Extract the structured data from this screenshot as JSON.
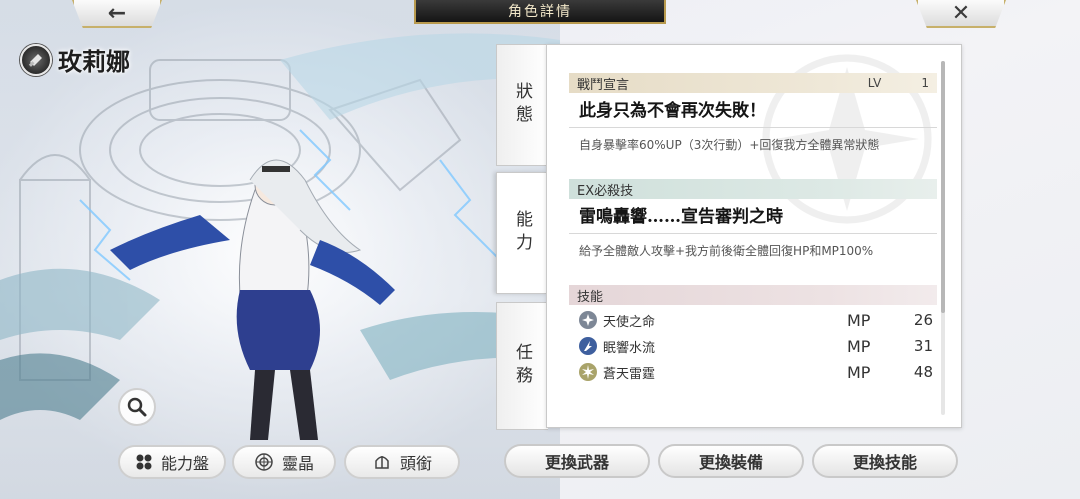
{
  "header": {
    "back_icon": "←",
    "close_icon": "✕",
    "title": "角色詳情"
  },
  "character": {
    "name": "玫莉娜"
  },
  "tabs": [
    {
      "label": "狀態",
      "active": false
    },
    {
      "label": "能力",
      "active": true
    },
    {
      "label": "任務",
      "active": false
    }
  ],
  "ability": {
    "battle_cry": {
      "header": "戰鬥宣言",
      "lv_label": "LV",
      "lv_value": "1",
      "title": "此身只為不會再次失敗！",
      "desc": "自身暴擊率60%UP（3次行動）+回復我方全體異常狀態"
    },
    "ex_skill": {
      "header": "EX必殺技",
      "title": "雷鳴轟響……宣告審判之時",
      "desc": "給予全體敵人攻擊+我方前後衛全體回復HP和MP100%"
    },
    "skills": {
      "header": "技能",
      "items": [
        {
          "name": "天使之命",
          "mp_label": "MP",
          "mp": "26",
          "icon": "angel-icon"
        },
        {
          "name": "眠響水流",
          "mp_label": "MP",
          "mp": "31",
          "icon": "water-icon"
        },
        {
          "name": "蒼天雷霆",
          "mp_label": "MP",
          "mp": "48",
          "icon": "thunder-icon"
        }
      ]
    }
  },
  "bottom_left": {
    "ability_board": "能力盤",
    "soul_crystal": "靈晶",
    "title": "頭銜"
  },
  "actions": {
    "change_weapon": "更換武器",
    "change_gear": "更換裝備",
    "change_skill": "更換技能"
  },
  "colors": {
    "gold_border": "#c7b06a",
    "header_beige": "#e6dcc6",
    "header_teal": "#cfe0db",
    "header_pink": "#e5d6d8"
  }
}
